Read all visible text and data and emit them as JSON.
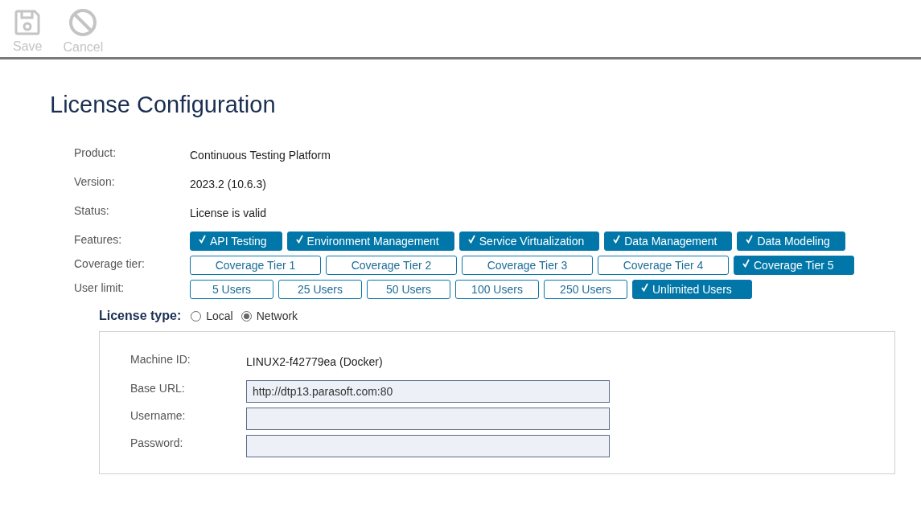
{
  "toolbar": [
    {
      "kind": "save",
      "label": "Save",
      "disabled": true
    },
    {
      "kind": "cancel",
      "label": "Cancel",
      "disabled": true
    }
  ],
  "title": "License Configuration",
  "info": [
    {
      "label": "Product:",
      "value": "Continuous Testing Platform"
    },
    {
      "label": "Version:",
      "value": "2023.2 (10.6.3)"
    },
    {
      "label": "Status:",
      "value": "License is valid"
    }
  ],
  "option_groups": [
    {
      "label": "Features:",
      "kind": "feature",
      "options": [
        {
          "label": "API Testing",
          "selected": true
        },
        {
          "label": "Environment Management",
          "selected": true
        },
        {
          "label": "Service Virtualization",
          "selected": true
        },
        {
          "label": "Data Management",
          "selected": true
        },
        {
          "label": "Data Modeling",
          "selected": true
        }
      ]
    },
    {
      "label": "Coverage tier:",
      "kind": "tier",
      "options": [
        {
          "label": "Coverage Tier 1",
          "selected": false
        },
        {
          "label": "Coverage Tier 2",
          "selected": false
        },
        {
          "label": "Coverage Tier 3",
          "selected": false
        },
        {
          "label": "Coverage Tier 4",
          "selected": false
        },
        {
          "label": "Coverage Tier 5",
          "selected": true
        }
      ]
    },
    {
      "label": "User limit:",
      "kind": "users",
      "options": [
        {
          "label": "5 Users",
          "selected": false
        },
        {
          "label": "25 Users",
          "selected": false
        },
        {
          "label": "50 Users",
          "selected": false
        },
        {
          "label": "100 Users",
          "selected": false
        },
        {
          "label": "250 Users",
          "selected": false
        },
        {
          "label": "Unlimited Users",
          "selected": true
        }
      ]
    }
  ],
  "license_type": {
    "label": "License type:",
    "options": [
      {
        "label": "Local",
        "selected": false
      },
      {
        "label": "Network",
        "selected": true
      }
    ]
  },
  "network": {
    "machine_id": {
      "label": "Machine ID:",
      "value": "LINUX2-f42779ea (Docker)"
    },
    "fields": [
      {
        "label": "Base URL:",
        "value": "http://dtp13.parasoft.com:80"
      },
      {
        "label": "Username:"
      },
      {
        "label": "Password:"
      }
    ]
  }
}
